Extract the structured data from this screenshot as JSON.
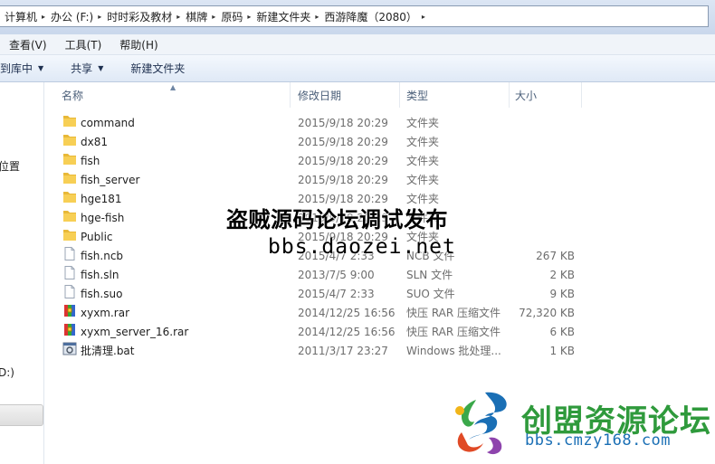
{
  "address": {
    "crumbs": [
      "计算机",
      "办公 (F:)",
      "时时彩及教材",
      "棋牌",
      "原码",
      "新建文件夹",
      "西游降魔（2080）"
    ]
  },
  "menu": [
    "查看(V)",
    "工具(T)",
    "帮助(H)"
  ],
  "toolbar": {
    "library": "到库中",
    "share": "共享",
    "new_folder": "新建文件夹"
  },
  "nav": {
    "item_locations": "位置",
    "item_drive": "D:)"
  },
  "columns": {
    "name": "名称",
    "date": "修改日期",
    "type": "类型",
    "size": "大小"
  },
  "files": [
    {
      "name": "command",
      "date": "2015/9/18 20:29",
      "type": "文件夹",
      "size": "",
      "icon": "folder-icon"
    },
    {
      "name": "dx81",
      "date": "2015/9/18 20:29",
      "type": "文件夹",
      "size": "",
      "icon": "folder-icon"
    },
    {
      "name": "fish",
      "date": "2015/9/18 20:29",
      "type": "文件夹",
      "size": "",
      "icon": "folder-icon"
    },
    {
      "name": "fish_server",
      "date": "2015/9/18 20:29",
      "type": "文件夹",
      "size": "",
      "icon": "folder-icon"
    },
    {
      "name": "hge181",
      "date": "2015/9/18 20:29",
      "type": "文件夹",
      "size": "",
      "icon": "folder-icon"
    },
    {
      "name": "hge-fish",
      "date": "2015/9/18 20:29",
      "type": "文件夹",
      "size": "",
      "icon": "folder-icon"
    },
    {
      "name": "Public",
      "date": "2015/9/18 20:29",
      "type": "文件夹",
      "size": "",
      "icon": "folder-icon"
    },
    {
      "name": "fish.ncb",
      "date": "2015/4/7 2:33",
      "type": "NCB 文件",
      "size": "267 KB",
      "icon": "document-icon"
    },
    {
      "name": "fish.sln",
      "date": "2013/7/5 9:00",
      "type": "SLN 文件",
      "size": "2 KB",
      "icon": "document-icon"
    },
    {
      "name": "fish.suo",
      "date": "2015/4/7 2:33",
      "type": "SUO 文件",
      "size": "9 KB",
      "icon": "document-icon"
    },
    {
      "name": "xyxm.rar",
      "date": "2014/12/25 16:56",
      "type": "快压 RAR 压缩文件",
      "size": "72,320 KB",
      "icon": "archive-icon"
    },
    {
      "name": "xyxm_server_16.rar",
      "date": "2014/12/25 16:56",
      "type": "快压 RAR 压缩文件",
      "size": "6 KB",
      "icon": "archive-icon"
    },
    {
      "name": "批清理.bat",
      "date": "2011/3/17 23:27",
      "type": "Windows 批处理...",
      "size": "1 KB",
      "icon": "batch-file-icon"
    }
  ],
  "watermark": {
    "line1": "盗贼源码论坛调试发布",
    "line2": "bbs.daozei.net",
    "logo_title": "创盟资源论坛",
    "logo_url": "bbs.cmzy168.com"
  },
  "colors": {
    "folder": "#e8b838",
    "logo_green": "#2f9a3c",
    "logo_blue": "#1a6fb5"
  }
}
